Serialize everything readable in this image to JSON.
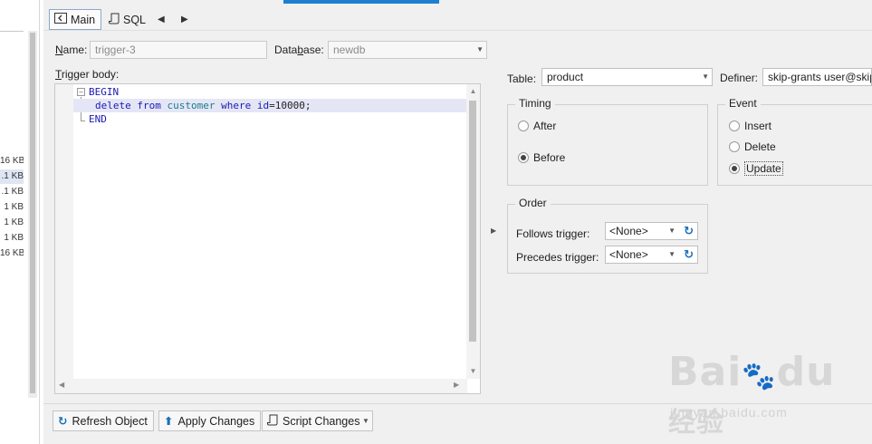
{
  "file_sizes": [
    {
      "text": "16 KB",
      "selected": false
    },
    {
      "text": ".1 KB",
      "selected": true
    },
    {
      "text": ".1 KB",
      "selected": false
    },
    {
      "text": "1 KB",
      "selected": false
    },
    {
      "text": "1 KB",
      "selected": false
    },
    {
      "text": "1 KB",
      "selected": false
    },
    {
      "text": "16 KB",
      "selected": false
    }
  ],
  "tabs": {
    "main": "Main",
    "sql": "SQL"
  },
  "form": {
    "name_label_u": "N",
    "name_label_rest": "ame:",
    "name_value": "trigger-3",
    "database_label_a": "Data",
    "database_label_u": "b",
    "database_label_b": "ase:",
    "database_value": "newdb",
    "trigger_body_label_u": "T",
    "trigger_body_label_rest": "rigger body:",
    "table_label": "Table:",
    "table_value": "product",
    "definer_label": "Definer:",
    "definer_value": "skip-grants user@skip"
  },
  "code": {
    "line1": "BEGIN",
    "line2_kw1": "delete from",
    "line2_tbl": "customer",
    "line2_kw2": "where",
    "line2_col": "id",
    "line2_rest": "=10000;",
    "line3": "END"
  },
  "timing": {
    "title": "Timing",
    "after": "After",
    "before": "Before",
    "selected": "Before"
  },
  "event": {
    "title": "Event",
    "insert": "Insert",
    "delete": "Delete",
    "update": "Update",
    "selected": "Update"
  },
  "order": {
    "title": "Order",
    "follows_label": "Follows trigger:",
    "follows_value": "<None>",
    "precedes_label": "Precedes trigger:",
    "precedes_value": "<None>"
  },
  "toolbar": {
    "refresh": "Refresh Object",
    "apply": "Apply Changes",
    "script": "Script Changes"
  },
  "watermark": {
    "logo": "Bai百du经验",
    "url": "jingyan.baidu.com"
  },
  "colors": {
    "accent": "#1c7fd0",
    "keyword": "#1a1ab4",
    "identifier": "#1a7d8c"
  }
}
